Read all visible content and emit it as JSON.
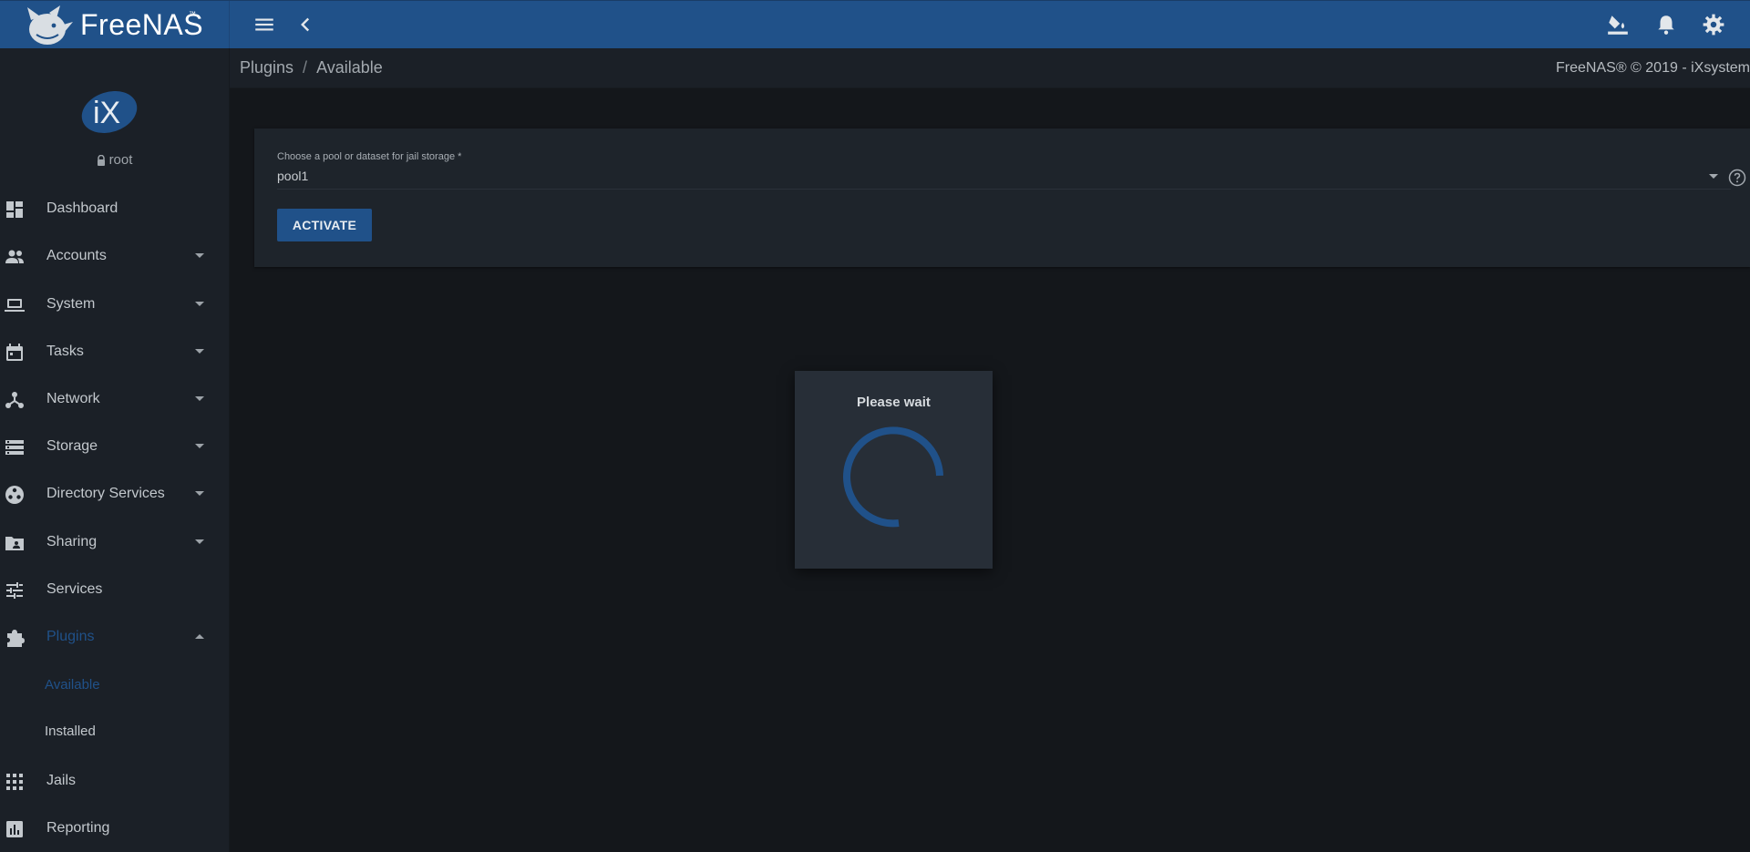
{
  "topbar": {
    "logo_text": "FreeNAS",
    "logo_tm": "™",
    "icons": [
      "menu-icon",
      "back-icon",
      "theme-icon",
      "bell-icon",
      "settings-icon"
    ]
  },
  "breadcrumb": {
    "items": [
      "Plugins",
      "Available"
    ],
    "separator": "/"
  },
  "copyright": "FreeNAS® © 2019 - iXsystem",
  "user": {
    "avatar_text": "iX",
    "name": "root"
  },
  "sidebar": {
    "items": [
      {
        "label": "Dashboard",
        "icon": "dashboard-icon"
      },
      {
        "label": "Accounts",
        "icon": "accounts-icon"
      },
      {
        "label": "System",
        "icon": "laptop-icon"
      },
      {
        "label": "Tasks",
        "icon": "calendar-icon"
      },
      {
        "label": "Network",
        "icon": "network-icon"
      },
      {
        "label": "Storage",
        "icon": "storage-icon"
      },
      {
        "label": "Directory Services",
        "icon": "directory-icon"
      },
      {
        "label": "Sharing",
        "icon": "sharing-icon"
      },
      {
        "label": "Services",
        "icon": "tune-icon"
      },
      {
        "label": "Plugins",
        "icon": "puzzle-icon"
      },
      {
        "label": "Jails",
        "icon": "apps-icon"
      },
      {
        "label": "Reporting",
        "icon": "chart-icon"
      }
    ],
    "plugins_sub": [
      {
        "label": "Available"
      },
      {
        "label": "Installed"
      }
    ]
  },
  "form": {
    "label": "Choose a pool or dataset for jail storage *",
    "value": "pool1",
    "activate_label": "ACTIVATE"
  },
  "dialog": {
    "title": "Please wait"
  },
  "colors": {
    "brand": "#205189",
    "background": "#14171b",
    "sidebar": "#1b2027",
    "card": "#1e242b"
  }
}
